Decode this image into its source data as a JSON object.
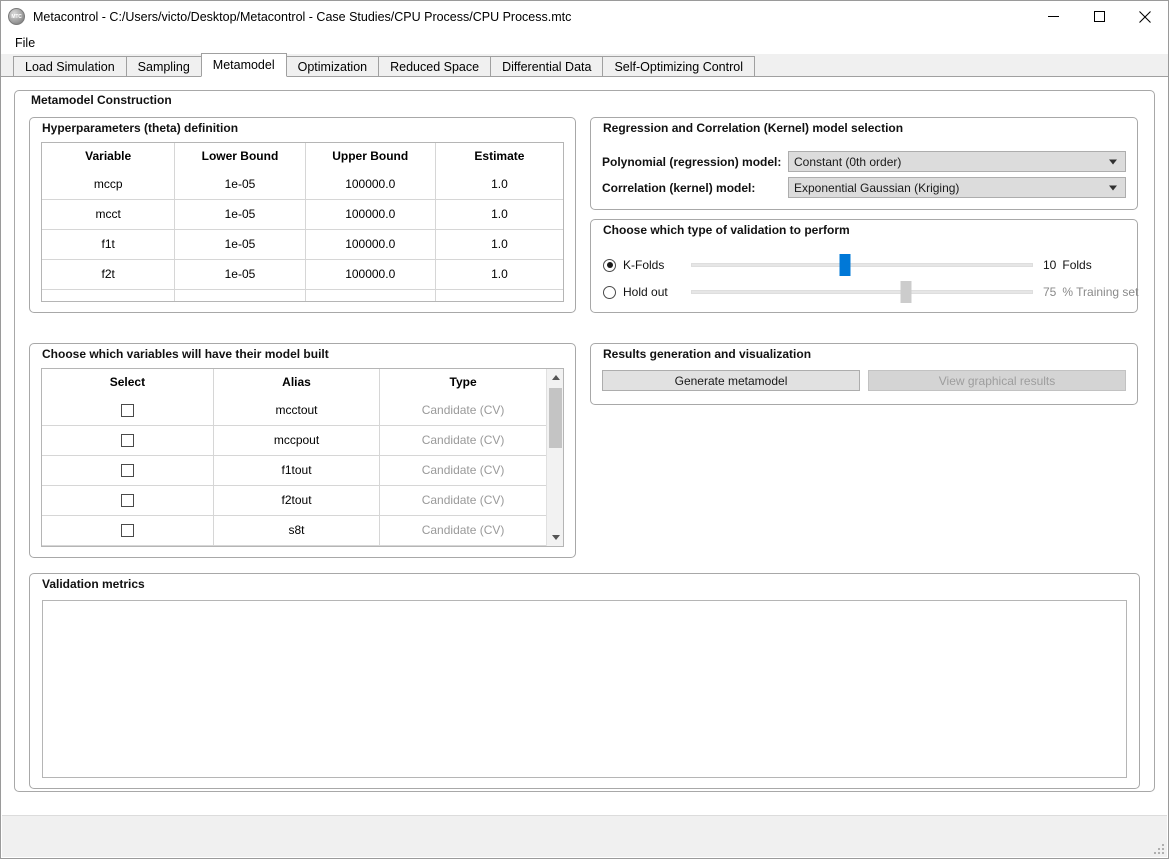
{
  "window": {
    "title": "Metacontrol - C:/Users/victo/Desktop/Metacontrol - Case Studies/CPU Process/CPU Process.mtc",
    "app_icon_text": "MTC",
    "minimize_label": "Minimize",
    "maximize_label": "Maximize",
    "close_label": "Close"
  },
  "menubar": {
    "items": [
      {
        "label": "File"
      }
    ]
  },
  "tabs": [
    {
      "label": "Load Simulation",
      "active": false
    },
    {
      "label": "Sampling",
      "active": false
    },
    {
      "label": "Metamodel",
      "active": true
    },
    {
      "label": "Optimization",
      "active": false
    },
    {
      "label": "Reduced Space",
      "active": false
    },
    {
      "label": "Differential Data",
      "active": false
    },
    {
      "label": "Self-Optimizing Control",
      "active": false
    }
  ],
  "main": {
    "title": "Metamodel Construction"
  },
  "hyperparameters": {
    "title": "Hyperparameters (theta) definition",
    "columns": [
      "Variable",
      "Lower Bound",
      "Upper Bound",
      "Estimate"
    ],
    "rows": [
      {
        "variable": "mccp",
        "lower": "1e-05",
        "upper": "100000.0",
        "estimate": "1.0"
      },
      {
        "variable": "mcct",
        "lower": "1e-05",
        "upper": "100000.0",
        "estimate": "1.0"
      },
      {
        "variable": "f1t",
        "lower": "1e-05",
        "upper": "100000.0",
        "estimate": "1.0"
      },
      {
        "variable": "f2t",
        "lower": "1e-05",
        "upper": "100000.0",
        "estimate": "1.0"
      }
    ]
  },
  "variables": {
    "title": "Choose which variables will have their model built",
    "columns": [
      "Select",
      "Alias",
      "Type"
    ],
    "rows": [
      {
        "checked": false,
        "alias": "mcctout",
        "type": "Candidate (CV)"
      },
      {
        "checked": false,
        "alias": "mccpout",
        "type": "Candidate (CV)"
      },
      {
        "checked": false,
        "alias": "f1tout",
        "type": "Candidate (CV)"
      },
      {
        "checked": false,
        "alias": "f2tout",
        "type": "Candidate (CV)"
      },
      {
        "checked": false,
        "alias": "s8t",
        "type": "Candidate (CV)"
      }
    ]
  },
  "kernel": {
    "title": "Regression and Correlation (Kernel) model selection",
    "polynomial_label": "Polynomial (regression) model:",
    "polynomial_value": "Constant (0th order)",
    "correlation_label": "Correlation (kernel) model:",
    "correlation_value": "Exponential Gaussian (Kriging)"
  },
  "validation": {
    "title": "Choose which type of validation to perform",
    "kfolds": {
      "label": "K-Folds",
      "selected": true,
      "value": "10",
      "unit": "Folds",
      "slider_percent": 45
    },
    "holdout": {
      "label": "Hold out",
      "selected": false,
      "value": "75",
      "unit": "% Training set",
      "slider_percent": 63
    }
  },
  "results": {
    "title": "Results generation and visualization",
    "generate_label": "Generate metamodel",
    "view_label": "View graphical results",
    "view_disabled": true
  },
  "metrics": {
    "title": "Validation metrics",
    "content": ""
  },
  "colors": {
    "accent": "#0078d7",
    "disabled_thumb": "#cccccc",
    "group_border": "#a8a8a8",
    "dim_text": "#9a9a9a"
  }
}
